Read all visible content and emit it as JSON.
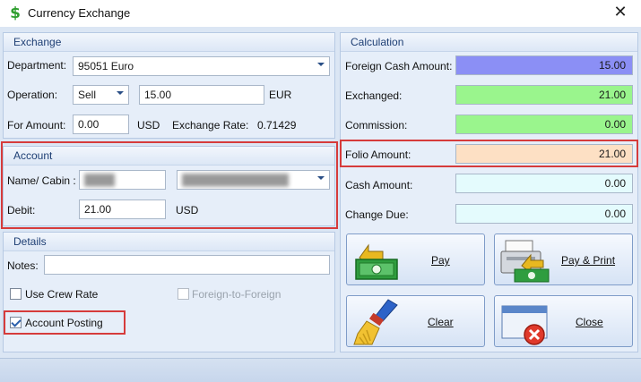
{
  "window": {
    "title": "Currency Exchange",
    "close_glyph": "✕",
    "icon": "dollar-icon"
  },
  "exchange": {
    "header": "Exchange",
    "department_label": "Department:",
    "department_value": "95051 Euro",
    "operation_label": "Operation:",
    "operation_value": "Sell",
    "amount_value": "15.00",
    "currency": "EUR",
    "for_amount_label": "For Amount:",
    "for_amount_value": "0.00",
    "for_amount_currency": "USD",
    "rate_label": "Exchange Rate:",
    "rate_value": "0.71429"
  },
  "account": {
    "header": "Account",
    "name_label": "Name/ Cabin :",
    "debit_label": "Debit:",
    "debit_value": "21.00",
    "debit_currency": "USD"
  },
  "details": {
    "header": "Details",
    "notes_label": "Notes:",
    "use_crew_rate": "Use Crew Rate",
    "foreign_to_foreign": "Foreign-to-Foreign",
    "account_posting": "Account Posting"
  },
  "calculation": {
    "header": "Calculation",
    "rows": [
      {
        "label": "Foreign Cash Amount:",
        "value": "15.00",
        "color": "#8b8ff5"
      },
      {
        "label": "Exchanged:",
        "value": "21.00",
        "color": "#9af58d"
      },
      {
        "label": "Commission:",
        "value": "0.00",
        "color": "#9af58d"
      },
      {
        "label": "Folio Amount:",
        "value": "21.00",
        "color": "#fde0c4"
      },
      {
        "label": "Cash Amount:",
        "value": "0.00",
        "color": "#e4fbfd"
      },
      {
        "label": "Change Due:",
        "value": "0.00",
        "color": "#e4fbfd"
      }
    ]
  },
  "buttons": {
    "pay": "Pay",
    "pay_print": "Pay & Print",
    "clear": "Clear",
    "close": "Close"
  },
  "colors": {
    "highlight": "#d63b3b",
    "group_header_text": "#1e3f74"
  }
}
